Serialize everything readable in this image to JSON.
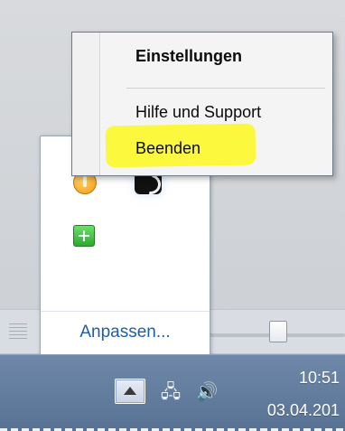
{
  "context_menu": {
    "items": [
      {
        "label": "Einstellungen"
      },
      {
        "label": "Hilfe und Support"
      },
      {
        "label": "Beenden"
      }
    ]
  },
  "tray_overflow": {
    "customize_label": "Anpassen..."
  },
  "taskbar": {
    "time": "10:51",
    "date": "03.04.201",
    "icons": {
      "show_hidden": "up-arrow-icon",
      "network": "network-icon",
      "volume": "speaker-icon"
    }
  },
  "colors": {
    "highlight": "#fff800",
    "link": "#1f5ea8",
    "taskbar": "#6f88a9"
  }
}
